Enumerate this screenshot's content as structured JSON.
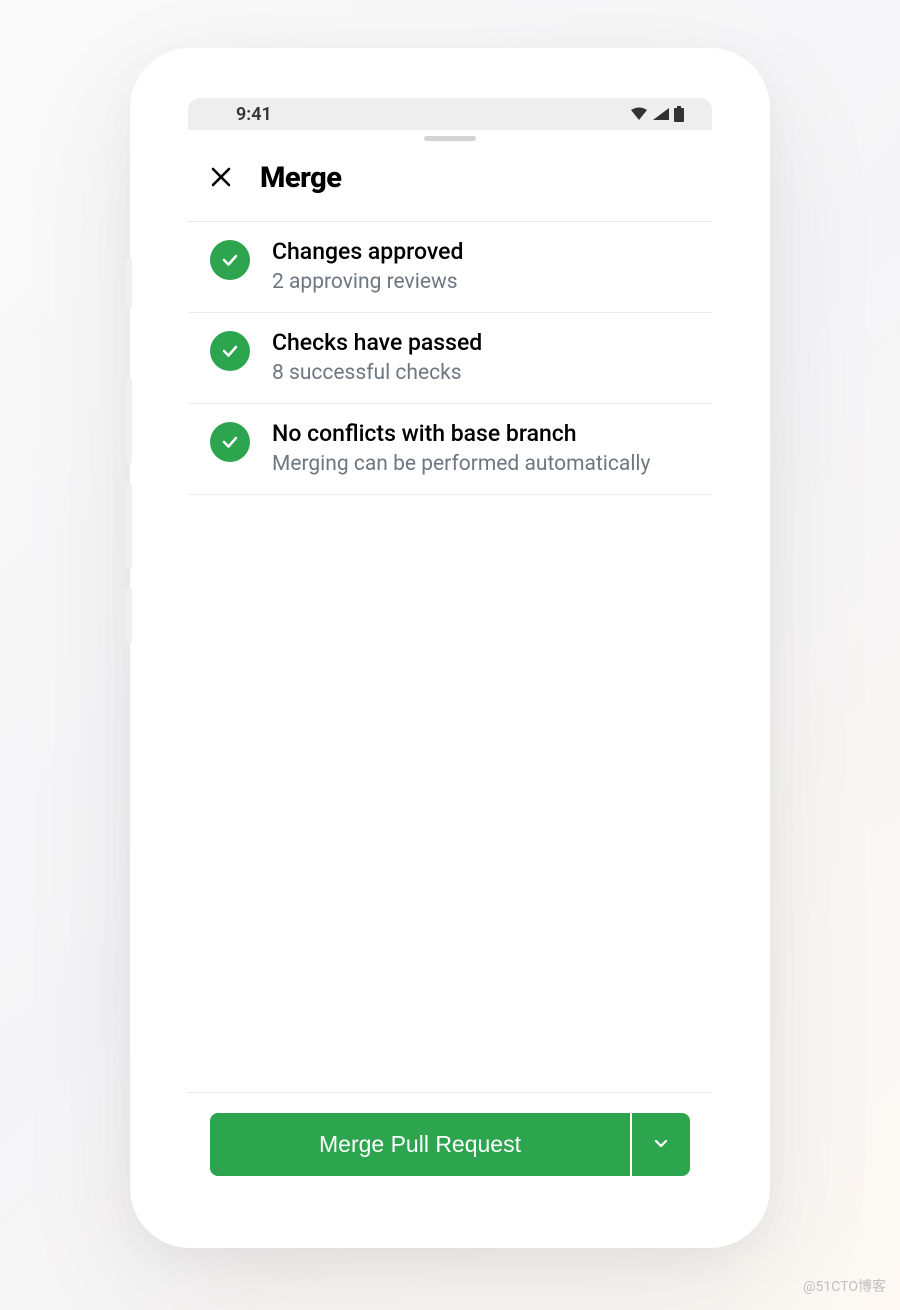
{
  "status_bar": {
    "time": "9:41"
  },
  "header": {
    "title": "Merge"
  },
  "items": [
    {
      "title": "Changes approved",
      "subtitle": "2 approving reviews"
    },
    {
      "title": "Checks have passed",
      "subtitle": "8 successful checks"
    },
    {
      "title": "No conflicts with base branch",
      "subtitle": "Merging can be performed automatically"
    }
  ],
  "actions": {
    "merge_button": "Merge Pull Request"
  },
  "colors": {
    "success": "#2da44e"
  },
  "watermark": "@51CTO博客"
}
